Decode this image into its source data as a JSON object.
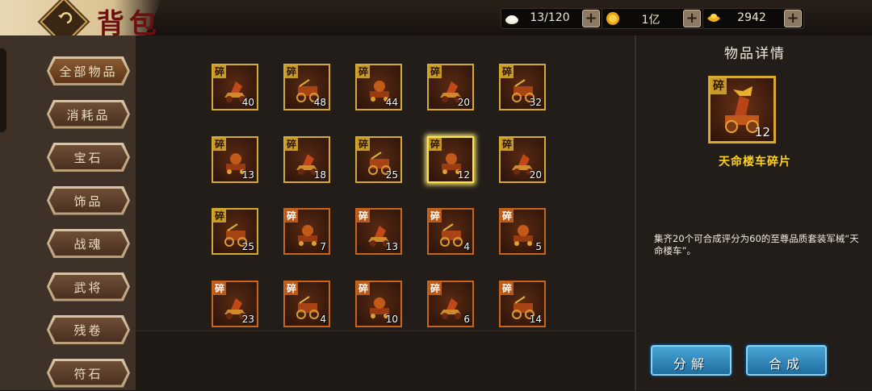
{
  "header": {
    "title": "背包",
    "resources": [
      {
        "icon": "bun-icon",
        "value": "13/120"
      },
      {
        "icon": "gold-coin-icon",
        "value": "1亿"
      },
      {
        "icon": "gold-ingot-icon",
        "value": "2942"
      }
    ]
  },
  "categories": [
    "全部物品",
    "消耗品",
    "宝石",
    "饰品",
    "战魂",
    "武将",
    "残卷",
    "符石"
  ],
  "items": [
    {
      "tag": "碎",
      "count": "40",
      "rarity": "gold"
    },
    {
      "tag": "碎",
      "count": "48",
      "rarity": "gold"
    },
    {
      "tag": "碎",
      "count": "44",
      "rarity": "gold"
    },
    {
      "tag": "碎",
      "count": "20",
      "rarity": "gold"
    },
    {
      "tag": "碎",
      "count": "32",
      "rarity": "gold"
    },
    {
      "tag": "碎",
      "count": "13",
      "rarity": "gold"
    },
    {
      "tag": "碎",
      "count": "18",
      "rarity": "gold"
    },
    {
      "tag": "碎",
      "count": "25",
      "rarity": "gold"
    },
    {
      "tag": "碎",
      "count": "12",
      "rarity": "gold",
      "selected": true
    },
    {
      "tag": "碎",
      "count": "20",
      "rarity": "gold"
    },
    {
      "tag": "碎",
      "count": "25",
      "rarity": "gold"
    },
    {
      "tag": "碎",
      "count": "7",
      "rarity": "orange"
    },
    {
      "tag": "碎",
      "count": "13",
      "rarity": "orange"
    },
    {
      "tag": "碎",
      "count": "4",
      "rarity": "orange"
    },
    {
      "tag": "碎",
      "count": "5",
      "rarity": "orange"
    },
    {
      "tag": "碎",
      "count": "23",
      "rarity": "orange"
    },
    {
      "tag": "碎",
      "count": "4",
      "rarity": "orange"
    },
    {
      "tag": "碎",
      "count": "10",
      "rarity": "orange"
    },
    {
      "tag": "碎",
      "count": "6",
      "rarity": "orange"
    },
    {
      "tag": "碎",
      "count": "14",
      "rarity": "orange"
    }
  ],
  "detail": {
    "title": "物品详情",
    "tag": "碎",
    "count": "12",
    "name": "天命楼车碎片",
    "description": "集齐20个可合成评分为60的至尊品质套装军械“天命楼车”。"
  },
  "actions": {
    "decompose": "分解",
    "compose": "合成"
  },
  "colors": {
    "gold_border": "#d4aa2f",
    "orange_border": "#c8651c",
    "name": "#ffd21c",
    "button": "#2a86bc"
  }
}
